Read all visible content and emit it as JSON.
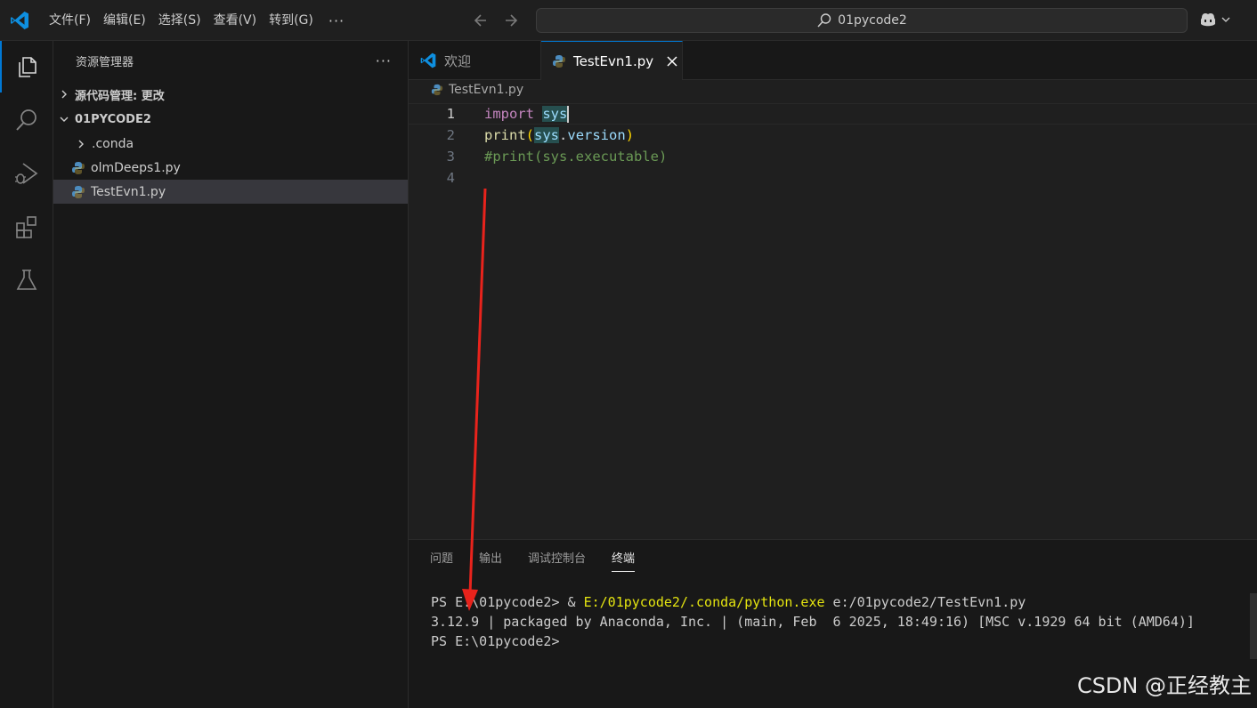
{
  "menu": {
    "items": [
      "文件(F)",
      "编辑(E)",
      "选择(S)",
      "查看(V)",
      "转到(G)"
    ],
    "more": "···"
  },
  "search": {
    "text": "01pycode2"
  },
  "sidebar": {
    "title": "资源管理器",
    "more": "···",
    "sections": {
      "scm": "源代码管理: 更改",
      "folder": "01PYCODE2"
    },
    "tree": [
      ".conda",
      "olmDeeps1.py",
      "TestEvn1.py"
    ]
  },
  "tabs": {
    "welcome": "欢迎",
    "active": "TestEvn1.py"
  },
  "breadcrumb": "TestEvn1.py",
  "code": {
    "line_numbers": [
      "1",
      "2",
      "3",
      "4"
    ],
    "l1_kw": "import",
    "l1_mod": "sys",
    "l2_fn": "print",
    "l2_open": "(",
    "l2_obj": "sys",
    "l2_dot": ".",
    "l2_attr": "version",
    "l2_close": ")",
    "l3_comment": "#print(sys.executable)"
  },
  "panel": {
    "tabs": [
      "问题",
      "输出",
      "调试控制台",
      "终端"
    ],
    "active_tab": "终端"
  },
  "terminal": {
    "l1_prompt": "PS E:\\01pycode2> ",
    "l1_amp": "& ",
    "l1_exe": "E:/01pycode2/.conda/python.exe",
    "l1_arg": " e:/01pycode2/TestEvn1.py",
    "l2": "3.12.9 | packaged by Anaconda, Inc. | (main, Feb  6 2025, 18:49:16) [MSC v.1929 64 bit (AMD64)]",
    "l3": "PS E:\\01pycode2>"
  },
  "watermark": "CSDN @正经教主",
  "icons": {
    "app": "vscode-logo-icon",
    "explorer": "files-icon",
    "search": "search-icon",
    "run": "run-debug-icon",
    "extensions": "extensions-icon",
    "testing": "flask-icon",
    "copilot": "copilot-icon",
    "python_file": "python-file-icon"
  },
  "colors": {
    "accent": "#0078d4",
    "annotation_arrow": "#e8231c",
    "keyword": "#c586c0",
    "function": "#dcdcaa",
    "variable": "#9cdcfe",
    "comment": "#6a9955",
    "terminal_path": "#e5e510"
  }
}
